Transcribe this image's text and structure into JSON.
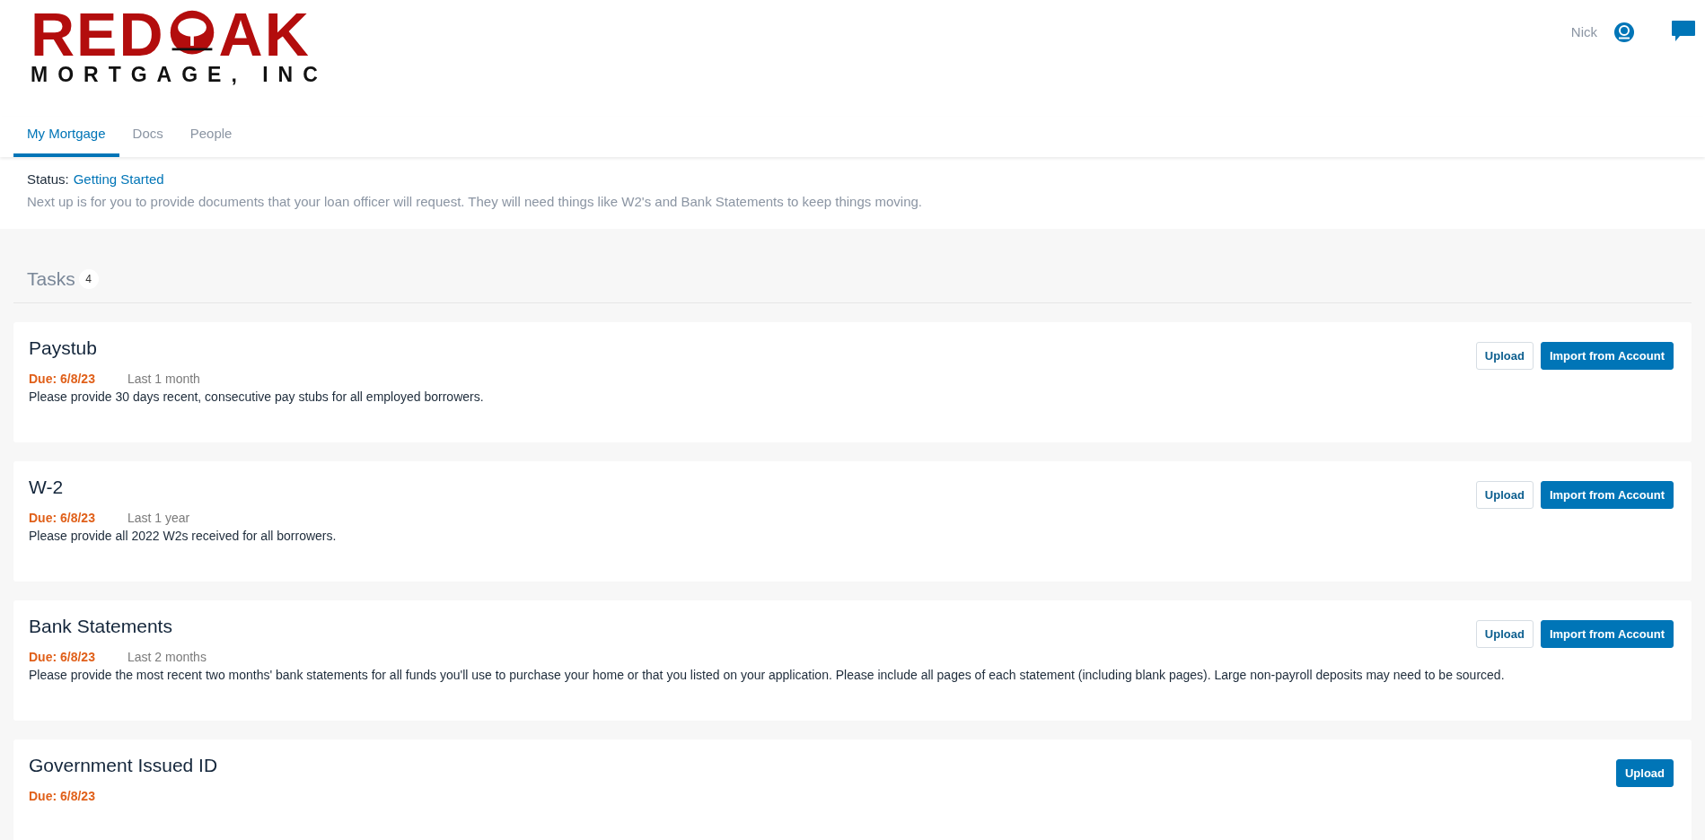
{
  "logo": {
    "word_start": "RED",
    "word_end": "AK",
    "tagline": "MORTGAGE, INC"
  },
  "user": {
    "name": "Nick"
  },
  "tabs": [
    {
      "label": "My Mortgage",
      "selected": true
    },
    {
      "label": "Docs",
      "selected": false
    },
    {
      "label": "People",
      "selected": false
    }
  ],
  "status": {
    "label": "Status:",
    "value": "Getting Started",
    "description": "Next up is for you to provide documents that your loan officer will request. They will need things like W2's and Bank Statements to keep things moving."
  },
  "tasks": {
    "title": "Tasks",
    "count": "4",
    "items": [
      {
        "title": "Paystub",
        "due": "Due: 6/8/23",
        "period": "Last 1 month",
        "description": "Please provide 30 days recent, consecutive pay stubs for all employed borrowers.",
        "buttons": [
          {
            "label": "Upload",
            "kind": "outline"
          },
          {
            "label": "Import from Account",
            "kind": "primary"
          }
        ]
      },
      {
        "title": "W-2",
        "due": "Due: 6/8/23",
        "period": "Last 1 year",
        "description": "Please provide all 2022 W2s received for all borrowers.",
        "buttons": [
          {
            "label": "Upload",
            "kind": "outline"
          },
          {
            "label": "Import from Account",
            "kind": "primary"
          }
        ]
      },
      {
        "title": "Bank Statements",
        "due": "Due: 6/8/23",
        "period": "Last 2 months",
        "description": "Please provide the most recent two months' bank statements for all funds you'll use to purchase your home or that you listed on your application. Please include all pages of each statement (including blank pages). Large non-payroll deposits may need to be sourced.",
        "buttons": [
          {
            "label": "Upload",
            "kind": "outline"
          },
          {
            "label": "Import from Account",
            "kind": "primary"
          }
        ]
      },
      {
        "title": "Government Issued ID",
        "due": "Due: 6/8/23",
        "buttons": [
          {
            "label": "Upload",
            "kind": "primary"
          }
        ]
      }
    ]
  }
}
